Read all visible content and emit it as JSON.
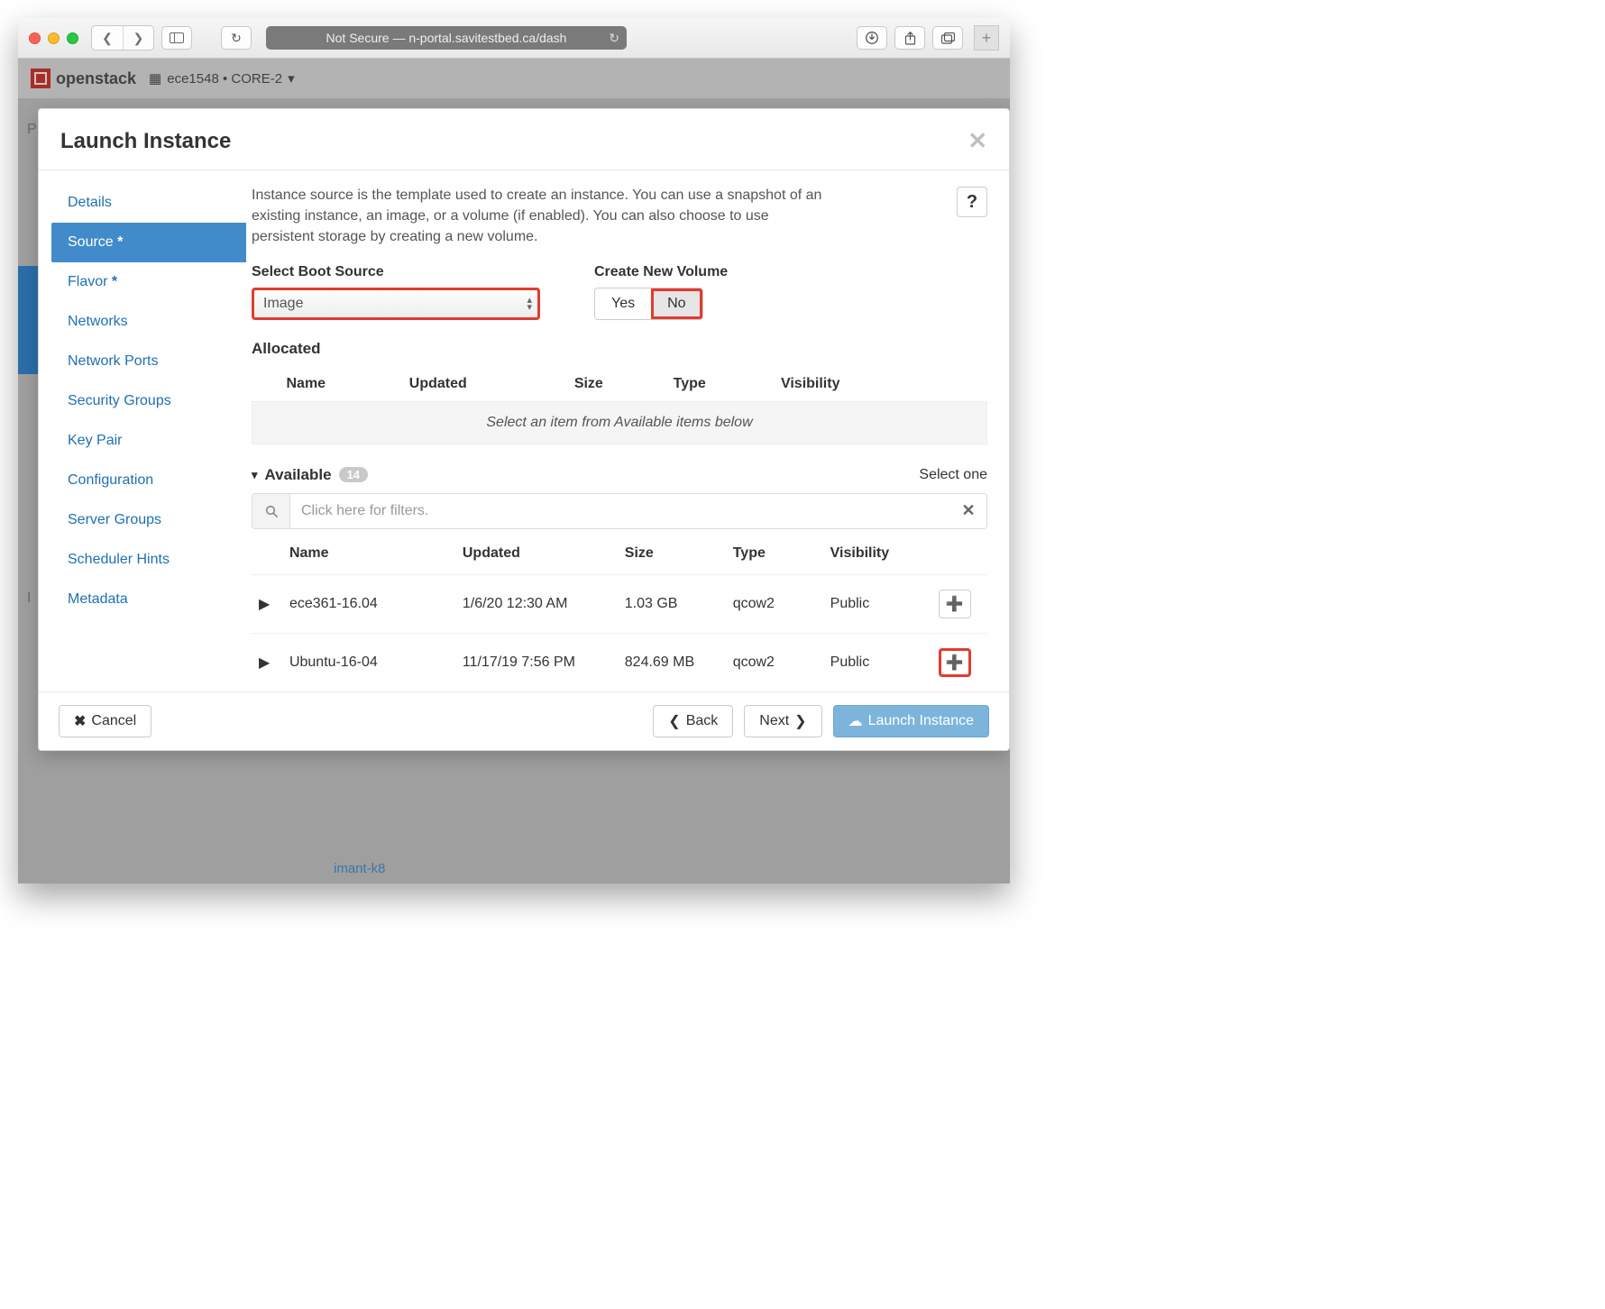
{
  "browser": {
    "url_label": "Not Secure — n-portal.savitestbed.ca/dash"
  },
  "page": {
    "brand": "openstack",
    "project_crumb": "ece1548 • CORE-2"
  },
  "bg_links": {
    "imant": "imant-k8"
  },
  "modal": {
    "title": "Launch Instance",
    "nav": {
      "details": "Details",
      "source": "Source",
      "flavor": "Flavor",
      "networks": "Networks",
      "network_ports": "Network Ports",
      "security_groups": "Security Groups",
      "key_pair": "Key Pair",
      "configuration": "Configuration",
      "server_groups": "Server Groups",
      "scheduler_hints": "Scheduler Hints",
      "metadata": "Metadata"
    },
    "description": "Instance source is the template used to create an instance. You can use a snapshot of an existing instance, an image, or a volume (if enabled). You can also choose to use persistent storage by creating a new volume.",
    "boot_source_label": "Select Boot Source",
    "boot_source_value": "Image",
    "create_vol_label": "Create New Volume",
    "toggle_yes": "Yes",
    "toggle_no": "No",
    "allocated_title": "Allocated",
    "alloc_cols": {
      "name": "Name",
      "updated": "Updated",
      "size": "Size",
      "type": "Type",
      "visibility": "Visibility"
    },
    "alloc_placeholder": "Select an item from Available items below",
    "available_title": "Available",
    "available_count": "14",
    "select_one": "Select one",
    "filter_placeholder": "Click here for filters.",
    "avail_cols": {
      "name": "Name",
      "updated": "Updated",
      "size": "Size",
      "type": "Type",
      "visibility": "Visibility"
    },
    "rows": [
      {
        "name": "ece361-16.04",
        "updated": "1/6/20 12:30 AM",
        "size": "1.03 GB",
        "type": "qcow2",
        "visibility": "Public"
      },
      {
        "name": "Ubuntu-16-04",
        "updated": "11/17/19 7:56 PM",
        "size": "824.69 MB",
        "type": "qcow2",
        "visibility": "Public"
      }
    ],
    "footer": {
      "cancel": "Cancel",
      "back": "Back",
      "next": "Next",
      "launch": "Launch Instance"
    }
  }
}
